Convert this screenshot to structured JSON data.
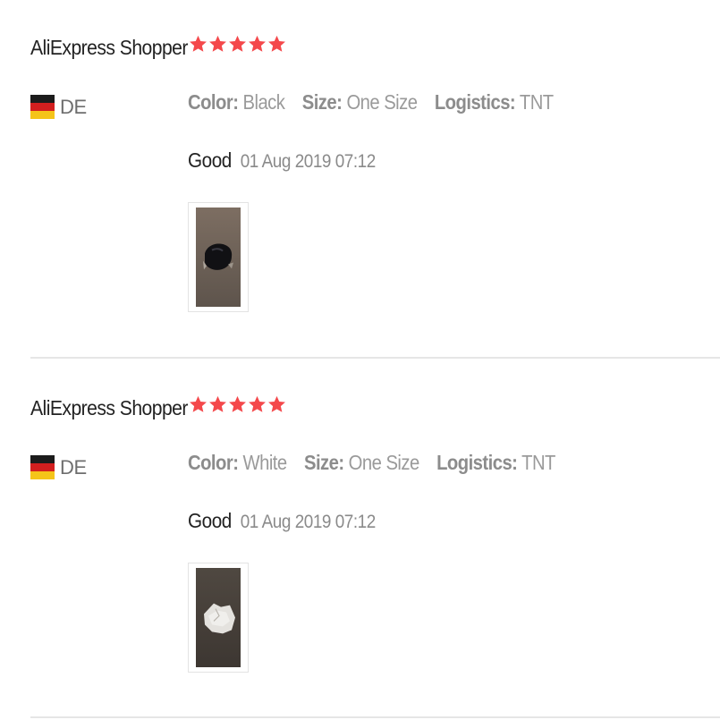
{
  "colors": {
    "star": "#f4484b",
    "author_text": "#222222",
    "meta_text": "#8c8c8c",
    "divider": "#e6e6e6"
  },
  "reviews": [
    {
      "author": "AliExpress Shopper",
      "rating": 5,
      "country_code": "DE",
      "flag_icon": "germany-flag-icon",
      "attributes": [
        {
          "label": "Color:",
          "value": "Black"
        },
        {
          "label": "Size:",
          "value": "One Size"
        },
        {
          "label": "Logistics:",
          "value": "TNT"
        }
      ],
      "comment": "Good",
      "date": "01 Aug 2019 07:12",
      "photo_icon": "review-photo-black-patch"
    },
    {
      "author": "AliExpress Shopper",
      "rating": 5,
      "country_code": "DE",
      "flag_icon": "germany-flag-icon",
      "attributes": [
        {
          "label": "Color:",
          "value": "White"
        },
        {
          "label": "Size:",
          "value": "One Size"
        },
        {
          "label": "Logistics:",
          "value": "TNT"
        }
      ],
      "comment": "Good",
      "date": "01 Aug 2019 07:12",
      "photo_icon": "review-photo-white-patch"
    }
  ]
}
